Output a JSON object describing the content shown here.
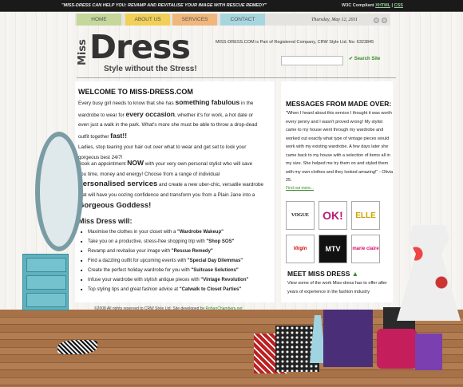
{
  "header": {
    "tagline": "\"MISS-DRESS CAN HELP YOU: REVAMP AND REVITALISE YOUR IMAGE WITH RESCUE REMEDY\"",
    "w3c_label": "W3C Compliant",
    "xhtml": "XHTML",
    "separator": "|",
    "css": "CSS"
  },
  "nav": [
    {
      "label": "HOME"
    },
    {
      "label": "ABOUT US"
    },
    {
      "label": "SERVICES"
    },
    {
      "label": "CONTACT"
    }
  ],
  "date": "Thursday, May 12, 2011",
  "logo": {
    "miss": "Miss",
    "dress": "Dress",
    "tagline": "Style without the Stress!"
  },
  "registration": "MISS-DRESS.COM is Part of Registered Company, CRW Style Ltd. No: 6323845",
  "search": {
    "value": "",
    "button_label": "Search Site"
  },
  "main": {
    "heading": "WELCOME TO MISS-DRESS.COM",
    "p1a": "Every busy girl needs to know that she has ",
    "p1b": "something fabulous",
    "p1c": " in the",
    "p1d": "wardrobe to wear for ",
    "p1e": "every occasion",
    "p1f": ", whether it's for work, a hot date or",
    "p1g": "even just a walk in the park. What's more she must be able to throw a drop-dead",
    "p1h": "outfit together ",
    "p1i": "fast!!",
    "p2": "Ladies, stop tearing your hair out over what to wear and get set to look your",
    "p2b": "gorgeous best 24/7!",
    "p3a": "Book an appointment ",
    "p3b": "NOW",
    "p3c": " with your very own personal stylist who will save",
    "p3d": "you time, money and energy! Choose from a range of individual",
    "p3e": "personalised services",
    "p3f": " and create a new uber-chic, versatile wardrobe",
    "p3g": "that will have you oozing confidence and transform you from a Plain Jane into a",
    "p3h": "Gorgeous Goddess!",
    "will_heading": "Miss Dress will:",
    "bullets": [
      {
        "text": "Maximise the clothes in your closet with a ",
        "bold": "\"Wardrobe Wakeup\""
      },
      {
        "text": "Take you on a productive, stress-free shopping trip with ",
        "bold": "\"Shop SOS\""
      },
      {
        "text": "Revamp and revitalise your image with ",
        "bold": "\"Rescue Remedy\""
      },
      {
        "text": "Find a dazzling outfit for upcoming events with ",
        "bold": "\"Special Day Dilemmas\""
      },
      {
        "text": "Create the perfect holiday wardrobe for you with ",
        "bold": "\"Suitcase Solutions\""
      },
      {
        "text": "Infuse your wardrobe with stylish antique pieces with ",
        "bold": "\"Vintage Revolution\""
      },
      {
        "text": "Top styling tips and great fashion advice at ",
        "bold": "\"Catwalk to Closet Parties\""
      }
    ]
  },
  "sidebar": {
    "messages_heading": "MESSAGES FROM MADE OVER:",
    "quote": "\"When I heard about this service I thought it was worth every penny and I wasn't proved wrong! My stylist came to my house went through my wardrobe and worked out exactly what type of vintage pieces would work with my existing wardrobe. A few days later she came back to my house with a selection of items all in my size. She helped me try them on and styled them with my own clothes and they looked amazing!\" - Olivia 25.",
    "find_more": "Find out more...",
    "magazines": [
      "VOGUE",
      "OK!",
      "ELLE",
      "Virgin",
      "MTV",
      "marie claire"
    ],
    "meet_heading": "MEET MISS DRESS",
    "meet_text": "View some of the work Miss-dress has to offer after years of experience in the fashion industry"
  },
  "footer": {
    "text": "©2008 All rights reserved to CRW Style Ltd. Site developed by ",
    "link": "RohanChambers.net"
  },
  "colors": {
    "home": "#c5d79a",
    "about": "#f2cf56",
    "services": "#f1b67b",
    "contact": "#a7d6df",
    "link_green": "#3a8a2c"
  }
}
